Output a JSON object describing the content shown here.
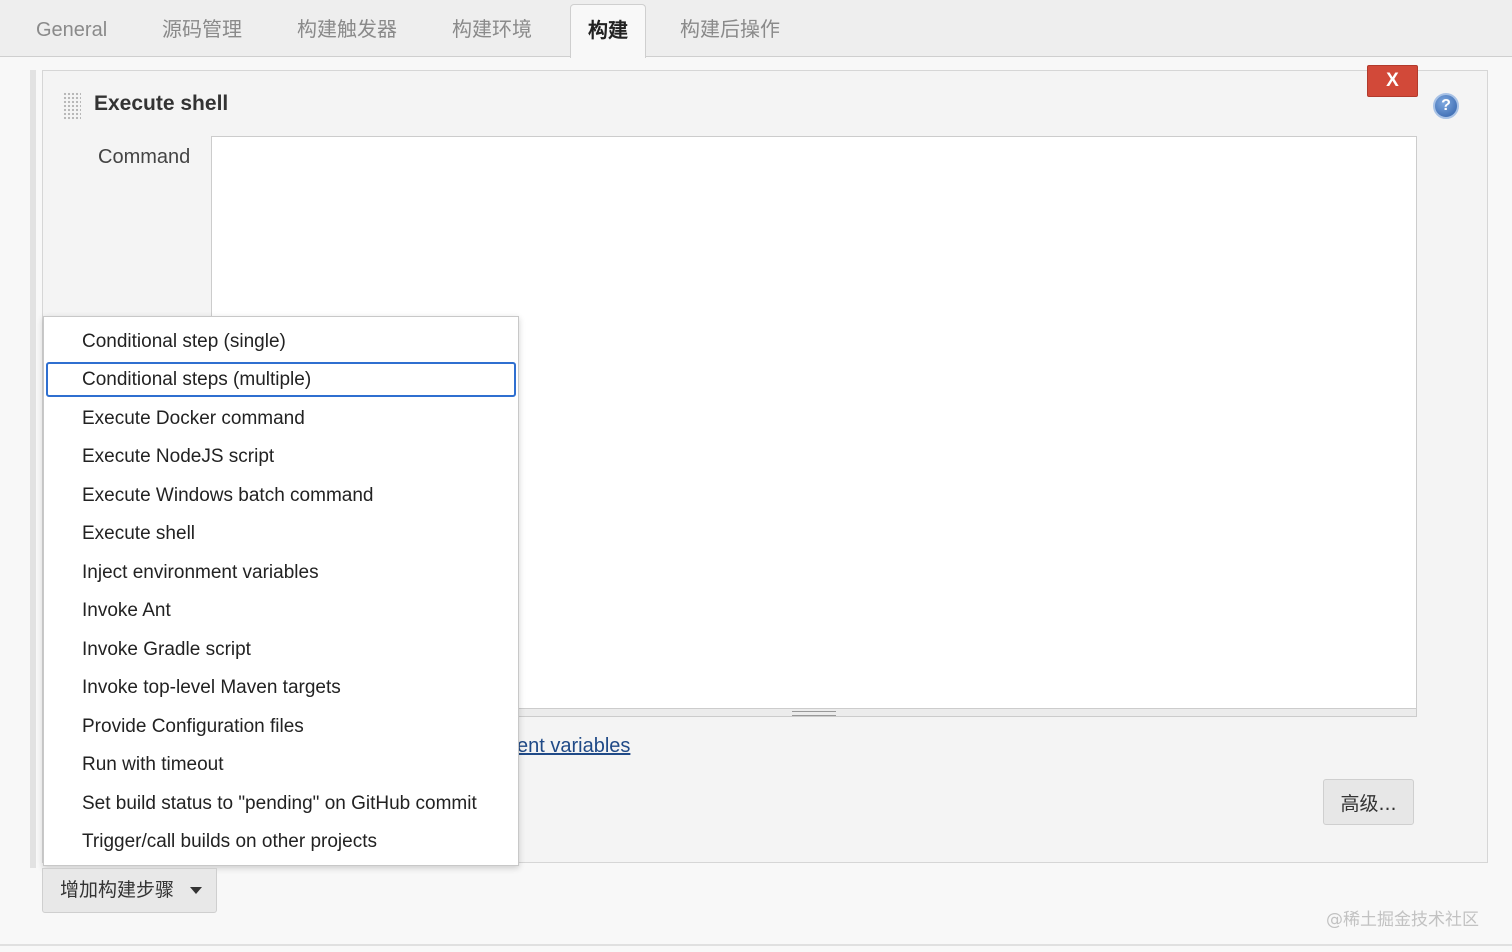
{
  "tabs": [
    {
      "label": "General"
    },
    {
      "label": "源码管理"
    },
    {
      "label": "构建触发器"
    },
    {
      "label": "构建环境"
    },
    {
      "label": "构建",
      "active": true
    },
    {
      "label": "构建后操作"
    }
  ],
  "build_step": {
    "title": "Execute shell",
    "close_label": "X",
    "help_label": "?",
    "command_label": "Command",
    "command_value": "",
    "env_link_visible_text": "ent variables",
    "advanced_label": "高级..."
  },
  "dropdown": {
    "focused_index": 1,
    "items": [
      "Conditional step (single)",
      "Conditional steps (multiple)",
      "Execute Docker command",
      "Execute NodeJS script",
      "Execute Windows batch command",
      "Execute shell",
      "Inject environment variables",
      "Invoke Ant",
      "Invoke Gradle script",
      "Invoke top-level Maven targets",
      "Provide Configuration files",
      "Run with timeout",
      "Set build status to \"pending\" on GitHub commit",
      "Trigger/call builds on other projects"
    ]
  },
  "add_step": {
    "label": "增加构建步骤"
  },
  "watermark": "@稀土掘金技术社区",
  "colors": {
    "close_button": "#d24939",
    "focus_ring": "#2f6fd0",
    "link": "#204a87"
  }
}
